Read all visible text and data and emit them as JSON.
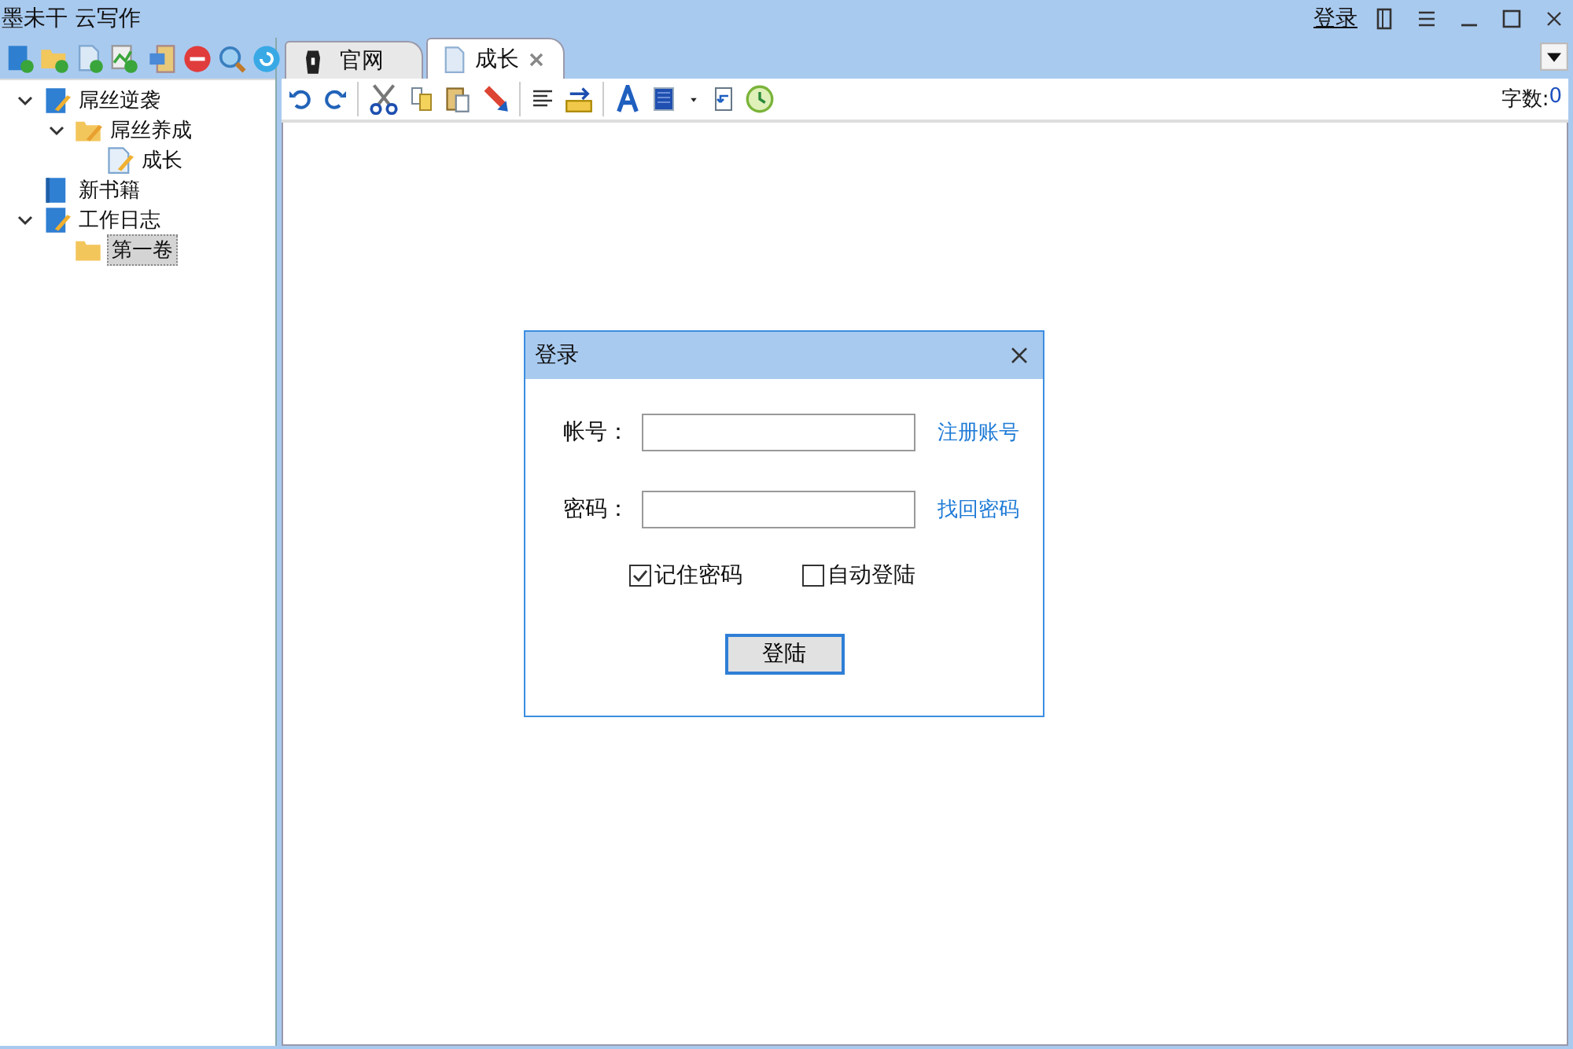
{
  "window": {
    "title": "墨未干 云写作",
    "login_link": "登录"
  },
  "sidebar": {
    "tree": [
      {
        "label": "屌丝逆袭",
        "kind": "book",
        "expanded": true,
        "selected": false,
        "children": [
          {
            "label": "屌丝养成",
            "kind": "volume",
            "expanded": true,
            "selected": false,
            "children": [
              {
                "label": "成长",
                "kind": "chapter",
                "selected": false
              }
            ]
          }
        ]
      },
      {
        "label": "新书籍",
        "kind": "new-book",
        "selected": false
      },
      {
        "label": "工作日志",
        "kind": "book",
        "expanded": true,
        "selected": false,
        "children": [
          {
            "label": "第一卷",
            "kind": "empty-volume",
            "selected": true
          }
        ]
      }
    ]
  },
  "tabs": [
    {
      "label": "官网",
      "kind": "site",
      "selected": false,
      "closable": false
    },
    {
      "label": "成长",
      "kind": "doc",
      "selected": true,
      "closable": true
    }
  ],
  "editor": {
    "word_count_label": "字数:",
    "word_count": "0"
  },
  "dialog": {
    "title": "登录",
    "fields": [
      {
        "label": "帐号：",
        "link": "注册账号"
      },
      {
        "label": "密码：",
        "link": "找回密码"
      }
    ],
    "checkboxes": [
      {
        "label": "记住密码",
        "checked": true
      },
      {
        "label": "自动登陆",
        "checked": false
      }
    ],
    "button": "登陆"
  }
}
